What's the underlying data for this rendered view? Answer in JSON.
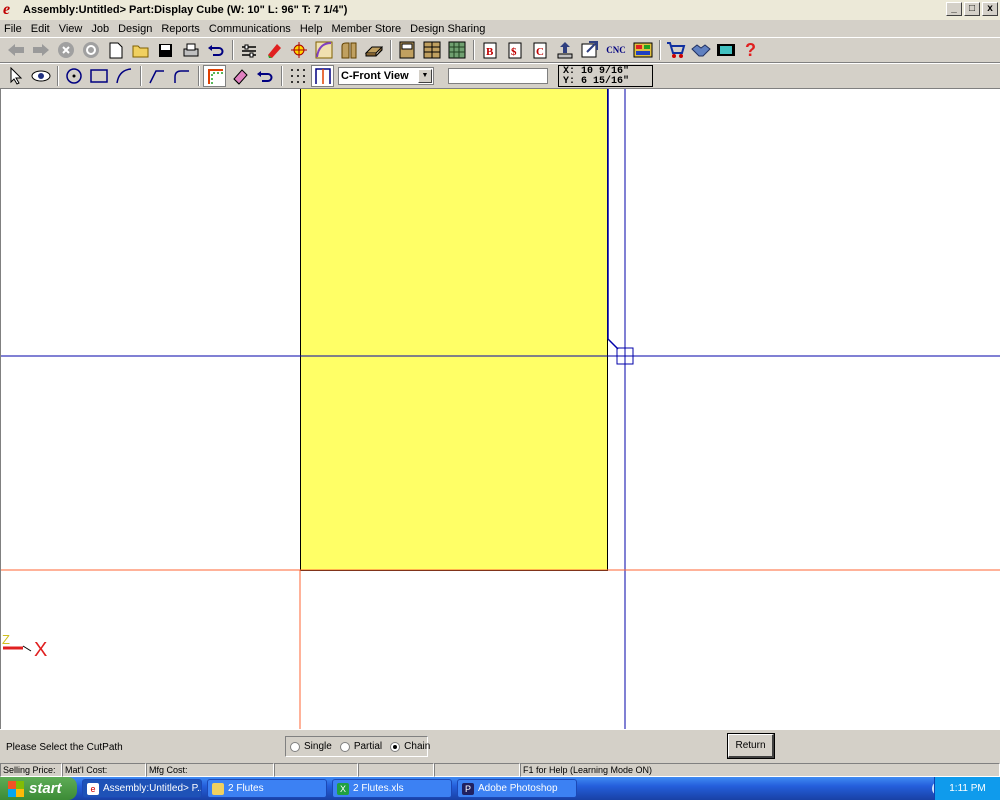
{
  "window": {
    "app_icon": "e",
    "title": "Assembly:Untitled> Part:Display Cube (W: 10\" L: 96\" T: 7 1/4\")",
    "controls": [
      "_",
      "□",
      "x"
    ]
  },
  "menu": [
    "File",
    "Edit",
    "View",
    "Job",
    "Design",
    "Reports",
    "Communications",
    "Help",
    "Member Store",
    "Design Sharing"
  ],
  "toolbar1": {
    "icons": [
      "back-arrow-icon",
      "forward-arrow-icon",
      "stop-icon",
      "refresh-icon",
      "new-document-icon",
      "open-folder-icon",
      "save-icon",
      "print-icon",
      "undo-icon",
      "settings-icon",
      "paint-icon",
      "tool-icon",
      "curve-icon",
      "molding-icon",
      "board-icon",
      "cabinet-icon",
      "cabinets-icon",
      "grid-icon",
      "B-report-icon",
      "dollar-report-icon",
      "C-report-icon",
      "export-icon",
      "import-icon",
      "cnc-icon",
      "palette-icon",
      "cart-icon",
      "handshake-icon",
      "film-icon",
      "help-icon"
    ],
    "cnc_label": "CNC",
    "help_label": "?"
  },
  "toolbar2": {
    "icons": [
      "pointer-icon",
      "eye-icon",
      "circle-icon",
      "rectangle-icon",
      "arc-icon",
      "line-icon",
      "corner-icon",
      "corner-border-icon",
      "eraser-icon",
      "undo-icon",
      "grid-dots-icon",
      "cutpath-icon"
    ],
    "view_select": "C-Front View",
    "coords_x": "X: 10 9/16\"",
    "coords_y": "Y: 6 15/16\""
  },
  "canvas": {
    "axis_label_x": "X",
    "axis_label_z": "Z"
  },
  "bottom": {
    "prompt": "Please Select the CutPath",
    "radio_single": "Single",
    "radio_partial": "Partial",
    "radio_chain": "Chain",
    "selected": "Chain",
    "return_label": "Return"
  },
  "status": {
    "selling_price": "Selling Price:",
    "matl_cost": "Mat'l Cost:",
    "mfg_cost": "Mfg Cost:",
    "help_text": "F1 for Help (Learning Mode ON)"
  },
  "taskbar": {
    "start": "start",
    "tasks": [
      "Assembly:Untitled> P...",
      "2 Flutes",
      "2 Flutes.xls",
      "Adobe Photoshop"
    ],
    "clock": "1:11 PM"
  },
  "colors": {
    "part_fill": "#ffff66",
    "axis_blue": "#0000aa",
    "axis_red": "#ff6633"
  }
}
